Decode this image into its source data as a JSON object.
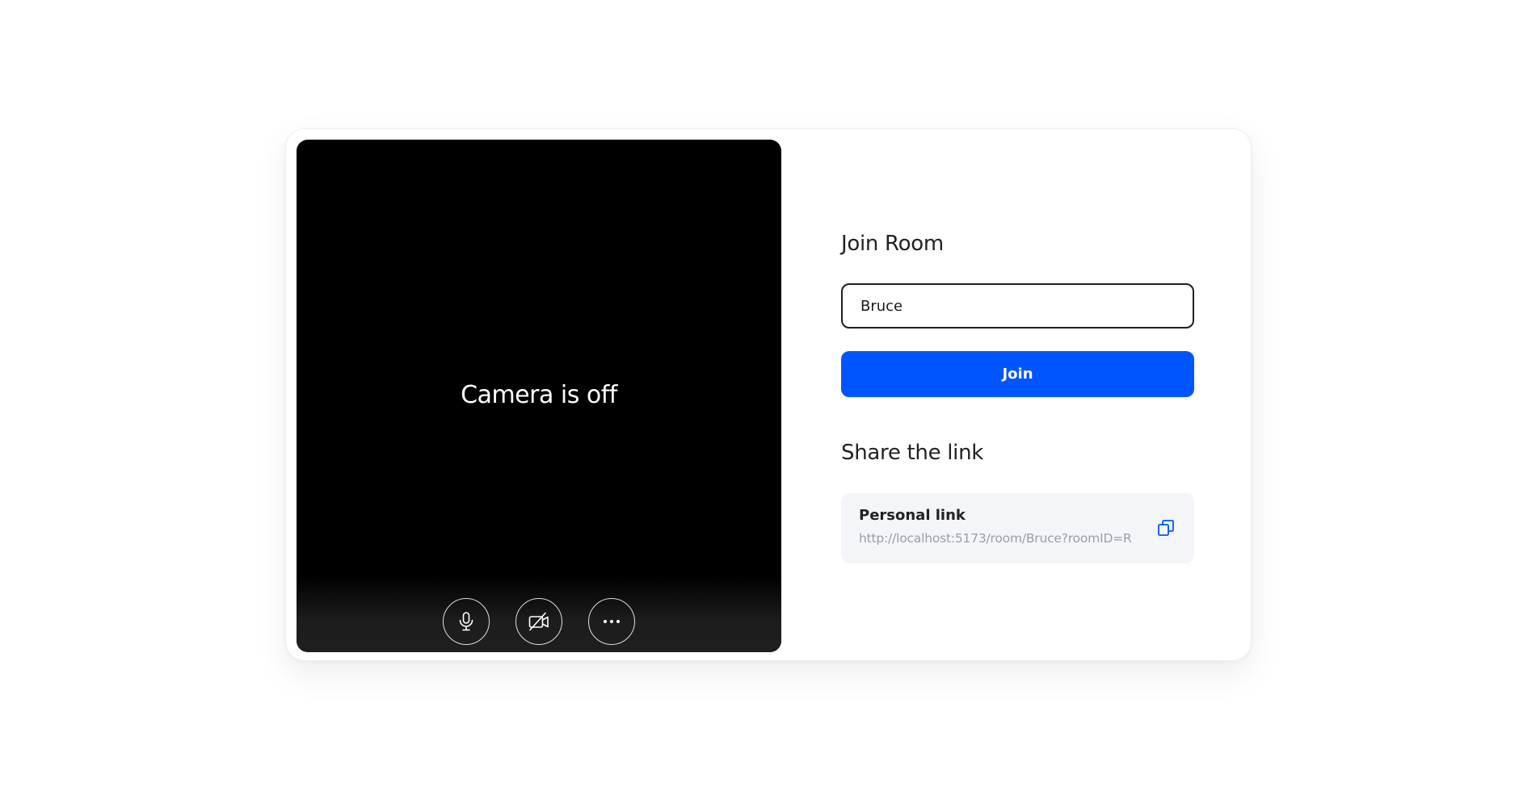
{
  "preview": {
    "camera_off_text": "Camera is off",
    "controls": [
      {
        "name": "microphone",
        "icon": "microphone-icon"
      },
      {
        "name": "camera",
        "icon": "camera-off-icon"
      },
      {
        "name": "more",
        "icon": "more-horizontal-icon"
      }
    ]
  },
  "join": {
    "heading": "Join Room",
    "name_value": "Bruce",
    "button_label": "Join"
  },
  "share": {
    "heading": "Share the link",
    "link_label": "Personal link",
    "link_url": "http://localhost:5173/room/Bruce?roomID=R",
    "copy_icon": "copy-icon"
  },
  "colors": {
    "accent": "#0055ff",
    "preview_bg": "#000000",
    "link_box_bg": "#f4f5f8"
  }
}
